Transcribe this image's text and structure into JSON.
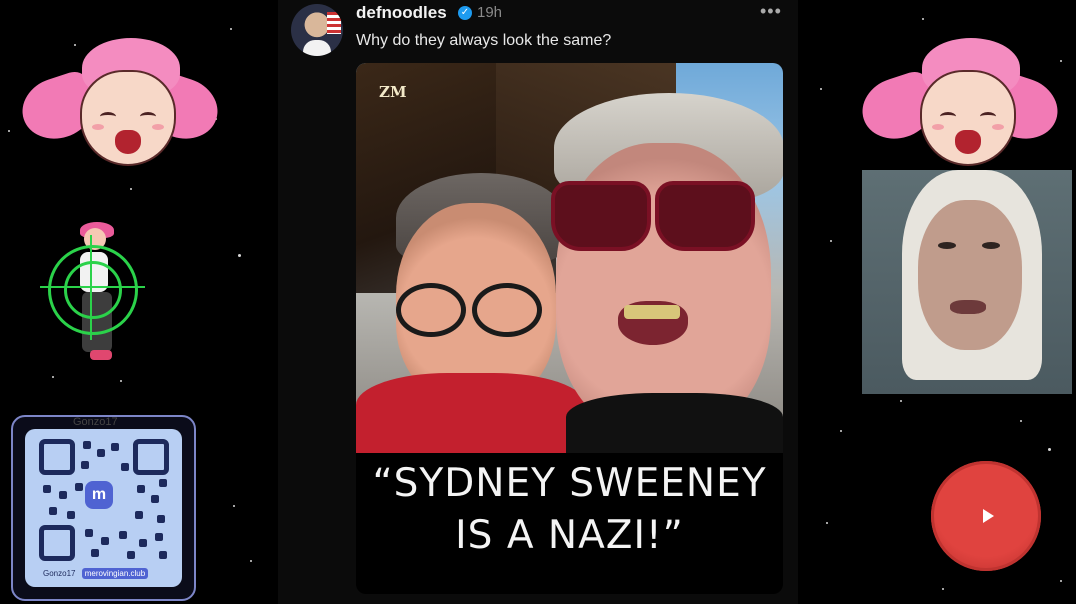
{
  "post": {
    "username": "defnoodles",
    "time": "19h",
    "more_label": "•••",
    "text": "Why do they always look the same?",
    "image_sign": "ZM",
    "caption_line1": "“SYDNEY SWEENEY",
    "caption_line2": "IS A NAZI!”"
  },
  "qr_card": {
    "top_label": "Gonzo17",
    "footer_user": "Gonzo17",
    "footer_site": "merovingian.club",
    "logo_glyph": "m"
  },
  "icons": {
    "verified": "verified-badge-icon",
    "play": "play-icon",
    "more": "more-options-icon"
  },
  "colors": {
    "background": "#000000",
    "verified": "#1d9bf0",
    "target": "#2bd24a",
    "play_button": "#e0433f",
    "qr_bg": "#b8cff3"
  }
}
